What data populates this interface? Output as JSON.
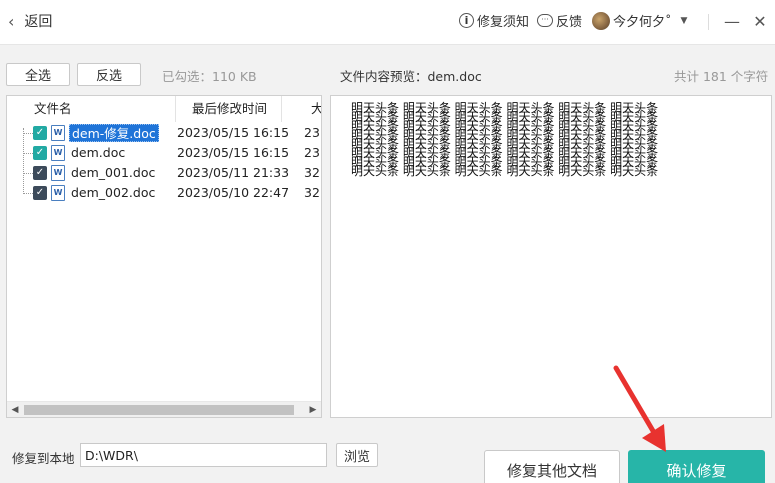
{
  "titlebar": {
    "back_label": "返回",
    "help_label": "修复须知",
    "feedback_label": "反馈",
    "user_name": "今夕何夕˚",
    "minimize": "—",
    "close": "✕"
  },
  "toolbar": {
    "select_all": "全选",
    "invert_select": "反选",
    "selected_info": "已勾选：110 KB",
    "preview_label": "文件内容预览：dem.doc",
    "char_count": "共计 181 个字符"
  },
  "file_list": {
    "columns": [
      "文件名",
      "最后修改时间",
      "大"
    ],
    "rows": [
      {
        "name": "dem-修复.doc",
        "modified": "2023/05/15 16:15",
        "size": "23",
        "checked": true,
        "selected": true,
        "check_color": "#21a9a3"
      },
      {
        "name": "dem.doc",
        "modified": "2023/05/15 16:15",
        "size": "23",
        "checked": true,
        "selected": false,
        "check_color": "#21a9a3"
      },
      {
        "name": "dem_001.doc",
        "modified": "2023/05/11 21:33",
        "size": "32",
        "checked": true,
        "selected": false,
        "check_color": "#3c4a5a"
      },
      {
        "name": "dem_002.doc",
        "modified": "2023/05/10 22:47",
        "size": "32",
        "checked": true,
        "selected": false,
        "check_color": "#3c4a5a"
      }
    ]
  },
  "preview": {
    "text": "明天头条 明天头条 明天头条 明天头条 明天头条 明天头条\n明天头条 明天头条 明天头条 明天头条 明天头条 明天头条\n明天头条 明天头条 明天头条 明天头条 明天头条 明天头条\n明天头条 明天头条 明天头条 明天头条 明天头条 明天头条\n明天头条 明天头条 明天头条 明天头条 明天头条 明天头条\n明天头条 明天头条 明天头条 明天头条 明天头条 明天头条\n明天头条 明天头条 明天头条 明天头条 明天头条 明天头条\n明天头条 明天头条 明天头条 明天头条 明天头条 明天头条"
  },
  "bottom": {
    "restore_label": "修复到本地",
    "path_value": "D:\\WDR\\",
    "browse": "浏览",
    "repair_other": "修复其他文档",
    "confirm": "确认修复"
  },
  "colors": {
    "accent": "#27b5a8",
    "selection": "#1f74d8",
    "arrow": "#e8322f"
  }
}
